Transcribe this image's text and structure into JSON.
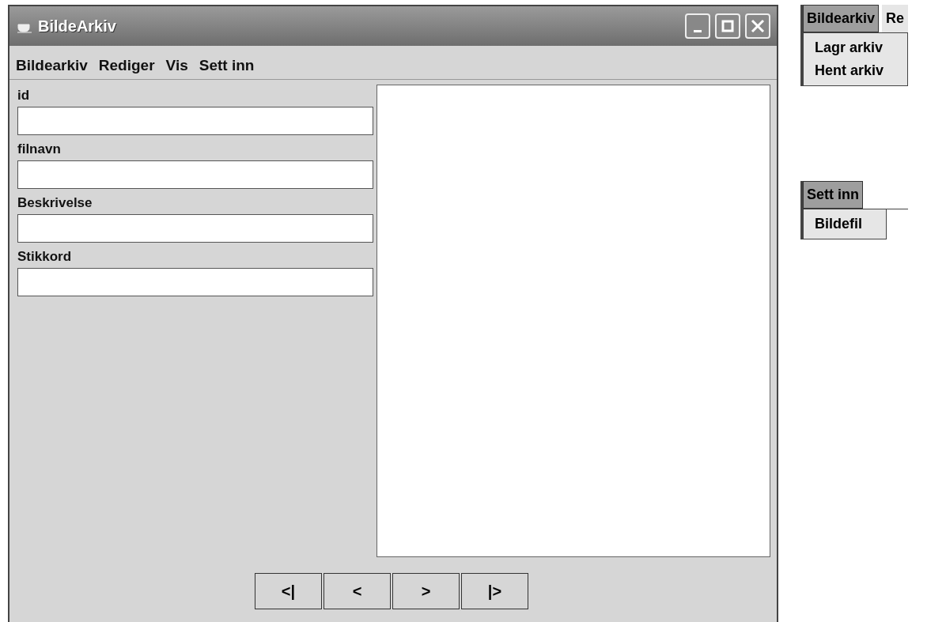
{
  "window": {
    "title": "BildeArkiv"
  },
  "menu_bar": [
    {
      "label": "Bildearkiv"
    },
    {
      "label": "Rediger"
    },
    {
      "label": "Vis"
    },
    {
      "label": "Sett inn"
    }
  ],
  "form": {
    "fields": [
      {
        "label": "id"
      },
      {
        "label": "filnavn"
      },
      {
        "label": "Beskrivelse"
      },
      {
        "label": "Stikkord"
      }
    ]
  },
  "navigation_buttons": [
    "<|",
    "<",
    ">",
    "|>"
  ],
  "menu_examples": [
    {
      "menu_bar": [
        {
          "label": "Bildearkiv",
          "selected": true
        },
        {
          "label": "Re",
          "selected": false
        }
      ],
      "items": [
        "Lagr arkiv",
        "Hent arkiv"
      ]
    },
    {
      "menu_bar": [
        {
          "label": "Sett inn",
          "selected": true
        }
      ],
      "items": [
        "Bildefil"
      ]
    }
  ]
}
